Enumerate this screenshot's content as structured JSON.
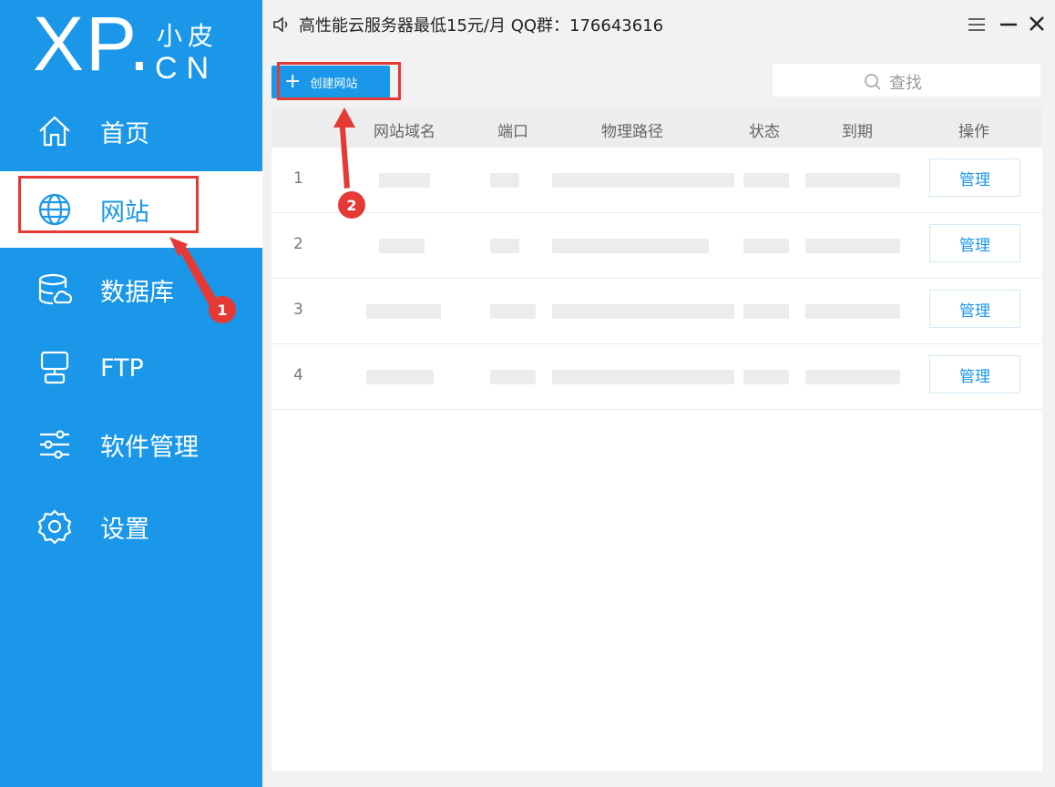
{
  "brand": {
    "logo_main": "XP.",
    "logo_top": "小皮",
    "logo_bottom": "CN"
  },
  "sidebar": {
    "items": [
      {
        "label": "首页",
        "icon": "home-icon"
      },
      {
        "label": "网站",
        "icon": "globe-icon",
        "active": true
      },
      {
        "label": "数据库",
        "icon": "database-icon"
      },
      {
        "label": "FTP",
        "icon": "ftp-icon"
      },
      {
        "label": "软件管理",
        "icon": "sliders-icon"
      },
      {
        "label": "设置",
        "icon": "gear-icon"
      }
    ]
  },
  "titlebar": {
    "notice": "高性能云服务器最低15元/月 QQ群：176643616"
  },
  "toolbar": {
    "create_label": "创建网站",
    "search_placeholder": "查找"
  },
  "table": {
    "headers": [
      "网站域名",
      "端口",
      "物理路径",
      "状态",
      "到期",
      "操作"
    ],
    "rows": [
      {
        "num": "1",
        "action": "管理"
      },
      {
        "num": "2",
        "action": "管理"
      },
      {
        "num": "3",
        "action": "管理"
      },
      {
        "num": "4",
        "action": "管理"
      }
    ]
  },
  "annotations": {
    "badge1": "1",
    "badge2": "2"
  },
  "colors": {
    "accent": "#1a97e8",
    "annotation": "#e53935"
  }
}
